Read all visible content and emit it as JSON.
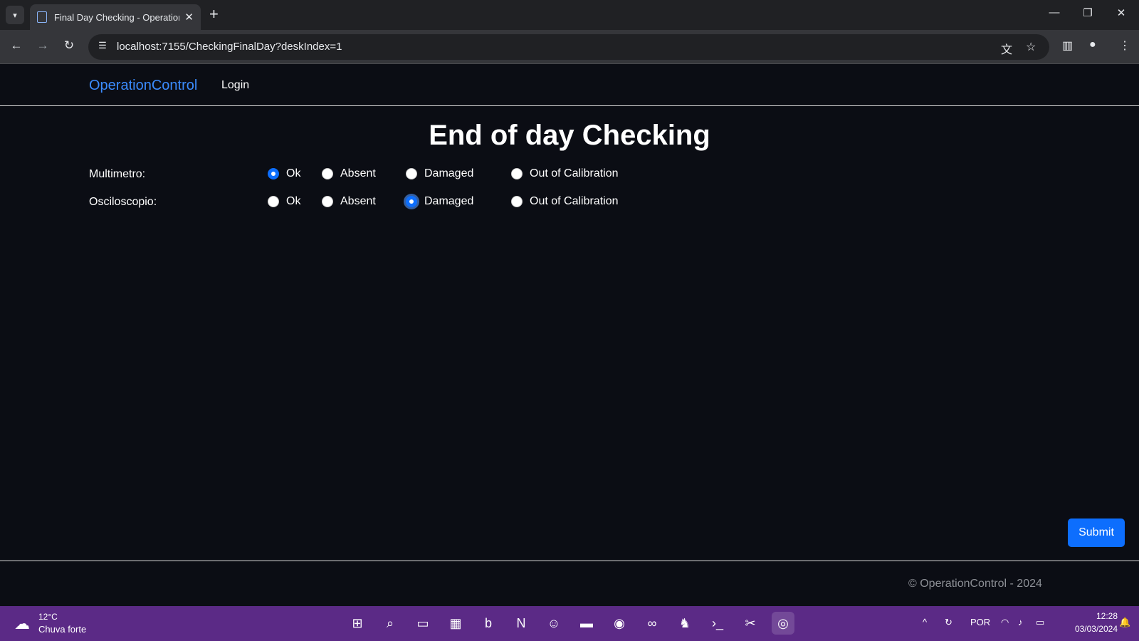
{
  "browser": {
    "tab_title": "Final Day Checking - OperationC",
    "url": "localhost:7155/CheckingFinalDay?deskIndex=1"
  },
  "navbar": {
    "brand": "OperationControl",
    "login": "Login"
  },
  "page": {
    "title": "End of day Checking",
    "rows": [
      {
        "label": "Multimetro:",
        "options": [
          "Ok",
          "Absent",
          "Damaged",
          "Out of Calibration"
        ],
        "selected": "Ok"
      },
      {
        "label": "Osciloscopio:",
        "options": [
          "Ok",
          "Absent",
          "Damaged",
          "Out of Calibration"
        ],
        "selected": "Damaged"
      }
    ],
    "submit": "Submit"
  },
  "footer": {
    "text": "© OperationControl - 2024"
  },
  "taskbar": {
    "weather_temp": "12°C",
    "weather_desc": "Chuva forte",
    "language": "POR",
    "time": "12:28",
    "date": "03/03/2024"
  },
  "colors": {
    "brand": "#3b8cff",
    "accent": "#0d6efd",
    "background": "#0b0d14",
    "taskbar": "#5b2a86"
  }
}
